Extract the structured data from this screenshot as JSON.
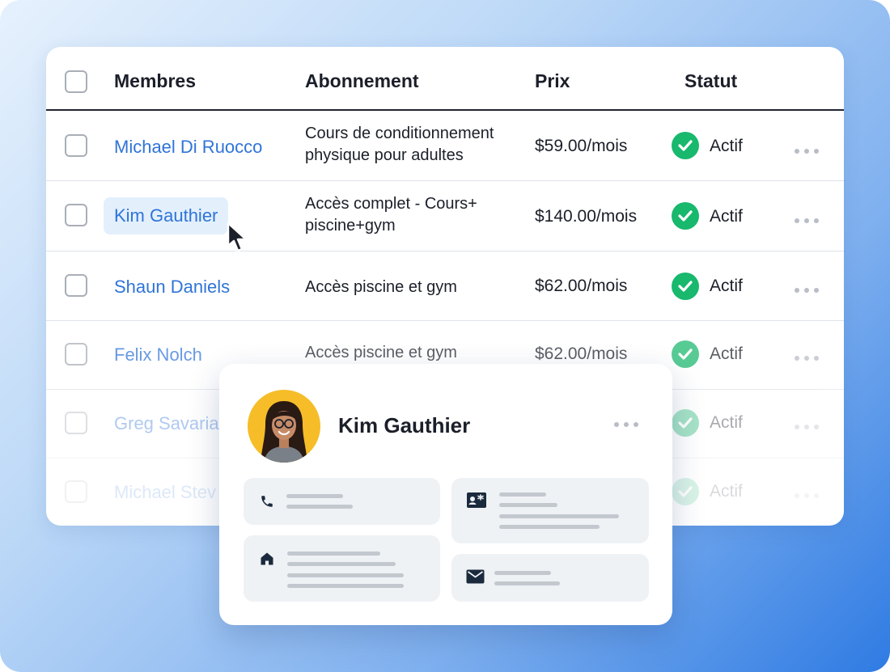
{
  "table": {
    "headers": {
      "members": "Membres",
      "subscription": "Abonnement",
      "price": "Prix",
      "status": "Statut"
    },
    "rows": [
      {
        "member": "Michael Di Ruocco",
        "subscription": "Cours de conditionnement physique pour adultes",
        "price": "$59.00/mois",
        "status": "Actif"
      },
      {
        "member": "Kim Gauthier",
        "subscription": "Accès complet - Cours+ piscine+gym",
        "price": "$140.00/mois",
        "status": "Actif"
      },
      {
        "member": "Shaun Daniels",
        "subscription": "Accès piscine et gym",
        "price": "$62.00/mois",
        "status": "Actif"
      },
      {
        "member": "Felix Nolch",
        "subscription": "Accès piscine et gym",
        "price": "$62.00/mois",
        "status": "Actif"
      },
      {
        "member": "Greg Savaria",
        "subscription": "",
        "price": "",
        "status": "Actif"
      },
      {
        "member": "Michael Stev",
        "subscription": "",
        "price": "",
        "status": "Actif"
      }
    ]
  },
  "popup": {
    "name": "Kim Gauthier",
    "icons": [
      "phone-icon",
      "contact-card-icon",
      "home-icon",
      "mail-icon"
    ]
  },
  "colors": {
    "link": "#2f74d8",
    "status_green": "#18b86d",
    "highlight": "#e3f0fc",
    "avatar_bg": "#f6bd28"
  }
}
